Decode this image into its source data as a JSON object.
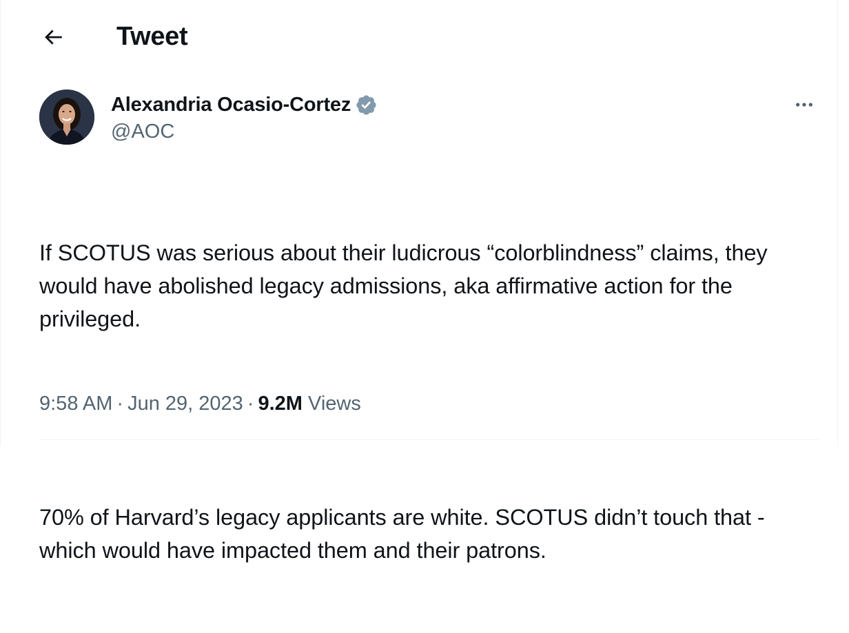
{
  "header": {
    "title": "Tweet",
    "back_icon": "arrow-left-icon"
  },
  "author": {
    "display_name": "Alexandria Ocasio-Cortez",
    "handle": "@AOC",
    "verified_icon": "verified-badge-icon",
    "verified_color": "#829aab",
    "more_icon": "more-horizontal-icon"
  },
  "tweet": {
    "paragraphs": [
      "If SCOTUS was serious about their ludicrous “colorblindness” claims, they would have abolished legacy admissions, aka affirmative action for the privileged.",
      "70% of Harvard’s legacy applicants are white. SCOTUS didn’t touch that - which would have impacted them and their patrons."
    ]
  },
  "meta": {
    "time": "9:58 AM",
    "separator": "·",
    "date": "Jun 29, 2023",
    "views_count": "9.2M",
    "views_label": "Views"
  },
  "colors": {
    "text_primary": "#0f1419",
    "text_secondary": "#536471",
    "border": "#eff3f4"
  }
}
